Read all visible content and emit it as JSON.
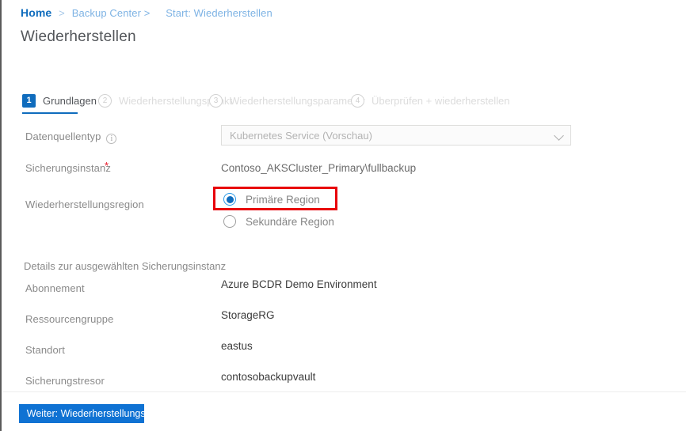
{
  "breadcrumb": {
    "home": "Home",
    "separator": ">",
    "item1": "Backup Center >",
    "item2": "Start: Wiederherstellen"
  },
  "page_title": "Wiederherstellen",
  "wizard": {
    "steps": [
      {
        "num": "1",
        "label": "Grundlagen",
        "active": true
      },
      {
        "num": "2",
        "label": "Wiederherstellungspunkt",
        "active": false
      },
      {
        "num": "3",
        "label": "Wiederherstellungsparameter",
        "active": false
      },
      {
        "num": "4",
        "label": "Überprüfen + wiederherstellen",
        "active": false
      }
    ]
  },
  "form": {
    "datasource_type_label": "Datenquellentyp",
    "datasource_type_value": "Kubernetes Service (Vorschau)",
    "backup_instance_label": "Sicherungsinstanz",
    "backup_instance_required": "*",
    "backup_instance_value": "Contoso_AKSCluster_Primary\\fullbackup",
    "restore_region_label": "Wiederherstellungsregion",
    "radio_primary": "Primäre Region",
    "radio_secondary": "Sekundäre Region",
    "selected_region": "Primäre Region"
  },
  "details": {
    "heading": "Details zur ausgewählten Sicherungsinstanz",
    "rows": [
      {
        "label": "Abonnement",
        "value": "Azure BCDR Demo Environment"
      },
      {
        "label": "Ressourcengruppe",
        "value": "StorageRG"
      },
      {
        "label": "Standort",
        "value": "eastus"
      },
      {
        "label": "Sicherungstresor",
        "value": "contosobackupvault"
      }
    ]
  },
  "footer": {
    "next_button": "Weiter: Wiederherstellungspunkt"
  },
  "icons": {
    "info": "i",
    "chevron_down": "chevron-down"
  },
  "colors": {
    "accent": "#0f6cbd",
    "highlight": "#e8000b",
    "required": "#e81123"
  }
}
